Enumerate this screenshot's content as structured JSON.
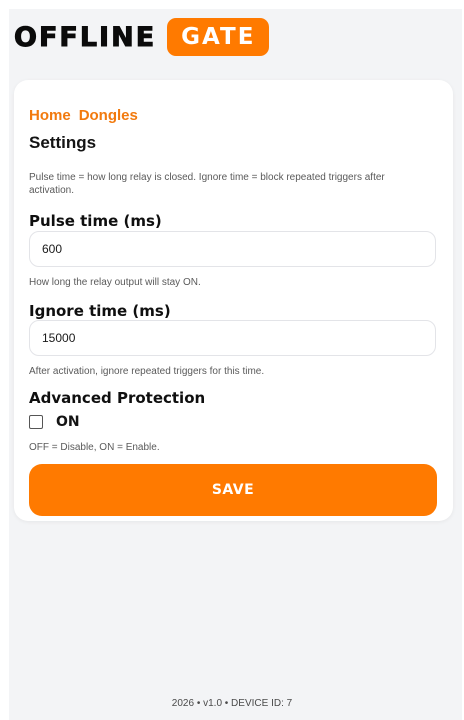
{
  "brand": {
    "main": "OFFLINE",
    "pill": "GATE"
  },
  "colors": {
    "accent": "#ff7a00",
    "page_bg": "#f3f4f6",
    "card_bg": "#ffffff"
  },
  "nav": {
    "home": "Home",
    "dongles": "Dongles"
  },
  "page_title": "Settings",
  "intro_note": "Pulse time = how long relay is closed. Ignore time = block repeated triggers after activation.",
  "pulse": {
    "label": "Pulse time (ms)",
    "value": "600",
    "hint": "How long the relay output will stay ON."
  },
  "ignore": {
    "label": "Ignore time (ms)",
    "value": "15000",
    "hint": "After activation, ignore repeated triggers for this time."
  },
  "advanced": {
    "label": "Advanced Protection",
    "checkbox_label": "ON",
    "checked": false,
    "hint": "OFF = Disable, ON = Enable."
  },
  "save_label": "SAVE",
  "footer": "2026 • v1.0 • DEVICE ID: 7"
}
